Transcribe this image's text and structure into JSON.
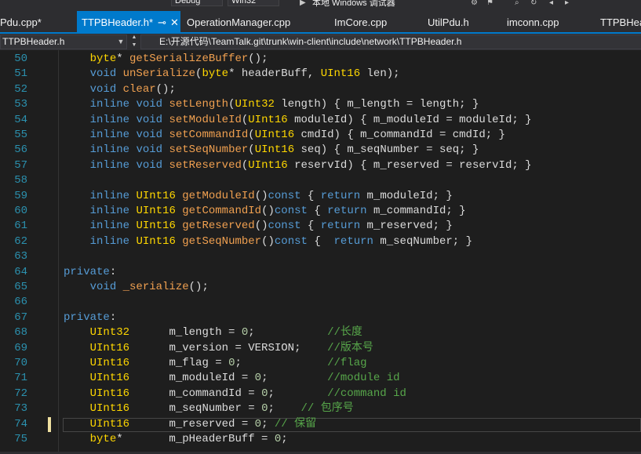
{
  "toolbar": {
    "config": "Debug",
    "platform": "Win32",
    "run_label": "本地 Windows 调试器"
  },
  "tabs": [
    {
      "label": "Pdu.cpp*",
      "active": false
    },
    {
      "label": "TTPBHeader.h*",
      "active": true
    },
    {
      "label": "OperationManager.cpp",
      "active": false
    },
    {
      "label": "ImCore.cpp",
      "active": false
    },
    {
      "label": "UtilPdu.h",
      "active": false
    },
    {
      "label": "imconn.cpp",
      "active": false
    },
    {
      "label": "TTPBHea",
      "active": false
    }
  ],
  "icons": {
    "pin": "pin-icon",
    "close": "close-icon"
  },
  "navbar": {
    "scope": "TTPBHeader.h",
    "path": "E:\\开源代码\\TeamTalk.git\\trunk\\win-client\\include\\network\\TTPBHeader.h"
  },
  "editor": {
    "active_line": "74",
    "lines": [
      {
        "n": "50",
        "t": [
          [
            "    ",
            ""
          ],
          [
            "byte",
            "ty"
          ],
          [
            "* ",
            ""
          ],
          [
            "getSerializeBuffer",
            "fn"
          ],
          [
            "();",
            ""
          ]
        ]
      },
      {
        "n": "51",
        "t": [
          [
            "    ",
            ""
          ],
          [
            "void",
            "kw"
          ],
          [
            " ",
            ""
          ],
          [
            "unSerialize",
            "fn"
          ],
          [
            "(",
            ""
          ],
          [
            "byte",
            "ty"
          ],
          [
            "* headerBuff, ",
            ""
          ],
          [
            "UInt16",
            "ty"
          ],
          [
            " len);",
            ""
          ]
        ]
      },
      {
        "n": "52",
        "t": [
          [
            "    ",
            ""
          ],
          [
            "void",
            "kw"
          ],
          [
            " ",
            ""
          ],
          [
            "clear",
            "fn"
          ],
          [
            "();",
            ""
          ]
        ]
      },
      {
        "n": "53",
        "t": [
          [
            "    ",
            ""
          ],
          [
            "inline",
            "kw"
          ],
          [
            " ",
            ""
          ],
          [
            "void",
            "kw"
          ],
          [
            " ",
            ""
          ],
          [
            "setLength",
            "fn"
          ],
          [
            "(",
            ""
          ],
          [
            "UInt32",
            "ty"
          ],
          [
            " length) { m_length = length; }",
            ""
          ]
        ]
      },
      {
        "n": "54",
        "t": [
          [
            "    ",
            ""
          ],
          [
            "inline",
            "kw"
          ],
          [
            " ",
            ""
          ],
          [
            "void",
            "kw"
          ],
          [
            " ",
            ""
          ],
          [
            "setModuleId",
            "fn"
          ],
          [
            "(",
            ""
          ],
          [
            "UInt16",
            "ty"
          ],
          [
            " moduleId) { m_moduleId = moduleId; }",
            ""
          ]
        ]
      },
      {
        "n": "55",
        "t": [
          [
            "    ",
            ""
          ],
          [
            "inline",
            "kw"
          ],
          [
            " ",
            ""
          ],
          [
            "void",
            "kw"
          ],
          [
            " ",
            ""
          ],
          [
            "setCommandId",
            "fn"
          ],
          [
            "(",
            ""
          ],
          [
            "UInt16",
            "ty"
          ],
          [
            " cmdId) { m_commandId = cmdId; }",
            ""
          ]
        ]
      },
      {
        "n": "56",
        "t": [
          [
            "    ",
            ""
          ],
          [
            "inline",
            "kw"
          ],
          [
            " ",
            ""
          ],
          [
            "void",
            "kw"
          ],
          [
            " ",
            ""
          ],
          [
            "setSeqNumber",
            "fn"
          ],
          [
            "(",
            ""
          ],
          [
            "UInt16",
            "ty"
          ],
          [
            " seq) { m_seqNumber = seq; }",
            ""
          ]
        ]
      },
      {
        "n": "57",
        "t": [
          [
            "    ",
            ""
          ],
          [
            "inline",
            "kw"
          ],
          [
            " ",
            ""
          ],
          [
            "void",
            "kw"
          ],
          [
            " ",
            ""
          ],
          [
            "setReserved",
            "fn"
          ],
          [
            "(",
            ""
          ],
          [
            "UInt16",
            "ty"
          ],
          [
            " reservId) { m_reserved = reservId; }",
            ""
          ]
        ]
      },
      {
        "n": "58",
        "t": []
      },
      {
        "n": "59",
        "t": [
          [
            "    ",
            ""
          ],
          [
            "inline",
            "kw"
          ],
          [
            " ",
            ""
          ],
          [
            "UInt16",
            "ty"
          ],
          [
            " ",
            ""
          ],
          [
            "getModuleId",
            "fn"
          ],
          [
            "()",
            ""
          ],
          [
            "const",
            "kw"
          ],
          [
            " { ",
            ""
          ],
          [
            "return",
            "kw"
          ],
          [
            " m_moduleId; }",
            ""
          ]
        ]
      },
      {
        "n": "60",
        "t": [
          [
            "    ",
            ""
          ],
          [
            "inline",
            "kw"
          ],
          [
            " ",
            ""
          ],
          [
            "UInt16",
            "ty"
          ],
          [
            " ",
            ""
          ],
          [
            "getCommandId",
            "fn"
          ],
          [
            "()",
            ""
          ],
          [
            "const",
            "kw"
          ],
          [
            " { ",
            ""
          ],
          [
            "return",
            "kw"
          ],
          [
            " m_commandId; }",
            ""
          ]
        ]
      },
      {
        "n": "61",
        "t": [
          [
            "    ",
            ""
          ],
          [
            "inline",
            "kw"
          ],
          [
            " ",
            ""
          ],
          [
            "UInt16",
            "ty"
          ],
          [
            " ",
            ""
          ],
          [
            "getReserved",
            "fn"
          ],
          [
            "()",
            ""
          ],
          [
            "const",
            "kw"
          ],
          [
            " { ",
            ""
          ],
          [
            "return",
            "kw"
          ],
          [
            " m_reserved; }",
            ""
          ]
        ]
      },
      {
        "n": "62",
        "t": [
          [
            "    ",
            ""
          ],
          [
            "inline",
            "kw"
          ],
          [
            " ",
            ""
          ],
          [
            "UInt16",
            "ty"
          ],
          [
            " ",
            ""
          ],
          [
            "getSeqNumber",
            "fn"
          ],
          [
            "()",
            ""
          ],
          [
            "const",
            "kw"
          ],
          [
            " {  ",
            ""
          ],
          [
            "return",
            "kw"
          ],
          [
            " m_seqNumber; }",
            ""
          ]
        ]
      },
      {
        "n": "63",
        "t": []
      },
      {
        "n": "64",
        "t": [
          [
            "private",
            "kw"
          ],
          [
            ":",
            ""
          ]
        ]
      },
      {
        "n": "65",
        "t": [
          [
            "    ",
            ""
          ],
          [
            "void",
            "kw"
          ],
          [
            " ",
            ""
          ],
          [
            "_serialize",
            "fn"
          ],
          [
            "();",
            ""
          ]
        ]
      },
      {
        "n": "66",
        "t": []
      },
      {
        "n": "67",
        "t": [
          [
            "private",
            "kw"
          ],
          [
            ":",
            ""
          ]
        ]
      },
      {
        "n": "68",
        "t": [
          [
            "    ",
            ""
          ],
          [
            "UInt32",
            "ty"
          ],
          [
            "      m_length = ",
            ""
          ],
          [
            "0",
            "nm"
          ],
          [
            ";           ",
            ""
          ],
          [
            "//长度",
            "cm"
          ]
        ]
      },
      {
        "n": "69",
        "t": [
          [
            "    ",
            ""
          ],
          [
            "UInt16",
            "ty"
          ],
          [
            "      m_version = VERSION;    ",
            ""
          ],
          [
            "//版本号",
            "cm"
          ]
        ]
      },
      {
        "n": "70",
        "t": [
          [
            "    ",
            ""
          ],
          [
            "UInt16",
            "ty"
          ],
          [
            "      m_flag = ",
            ""
          ],
          [
            "0",
            "nm"
          ],
          [
            ";             ",
            ""
          ],
          [
            "//flag",
            "cm"
          ]
        ]
      },
      {
        "n": "71",
        "t": [
          [
            "    ",
            ""
          ],
          [
            "UInt16",
            "ty"
          ],
          [
            "      m_moduleId = ",
            ""
          ],
          [
            "0",
            "nm"
          ],
          [
            ";         ",
            ""
          ],
          [
            "//module id",
            "cm"
          ]
        ]
      },
      {
        "n": "72",
        "t": [
          [
            "    ",
            ""
          ],
          [
            "UInt16",
            "ty"
          ],
          [
            "      m_commandId = ",
            ""
          ],
          [
            "0",
            "nm"
          ],
          [
            ";        ",
            ""
          ],
          [
            "//command id",
            "cm"
          ]
        ]
      },
      {
        "n": "73",
        "t": [
          [
            "    ",
            ""
          ],
          [
            "UInt16",
            "ty"
          ],
          [
            "      m_seqNumber = ",
            ""
          ],
          [
            "0",
            "nm"
          ],
          [
            ";    ",
            ""
          ],
          [
            "// 包序号",
            "cm"
          ]
        ]
      },
      {
        "n": "74",
        "t": [
          [
            "    ",
            ""
          ],
          [
            "UInt16",
            "ty"
          ],
          [
            "      m_reserved = ",
            ""
          ],
          [
            "0",
            "nm"
          ],
          [
            "; ",
            ""
          ],
          [
            "// 保留",
            "cm"
          ]
        ]
      },
      {
        "n": "75",
        "t": [
          [
            "    ",
            ""
          ],
          [
            "byte",
            "ty"
          ],
          [
            "*       m_pHeaderBuff = ",
            ""
          ],
          [
            "0",
            "nm"
          ],
          [
            ";",
            ""
          ]
        ]
      }
    ]
  }
}
